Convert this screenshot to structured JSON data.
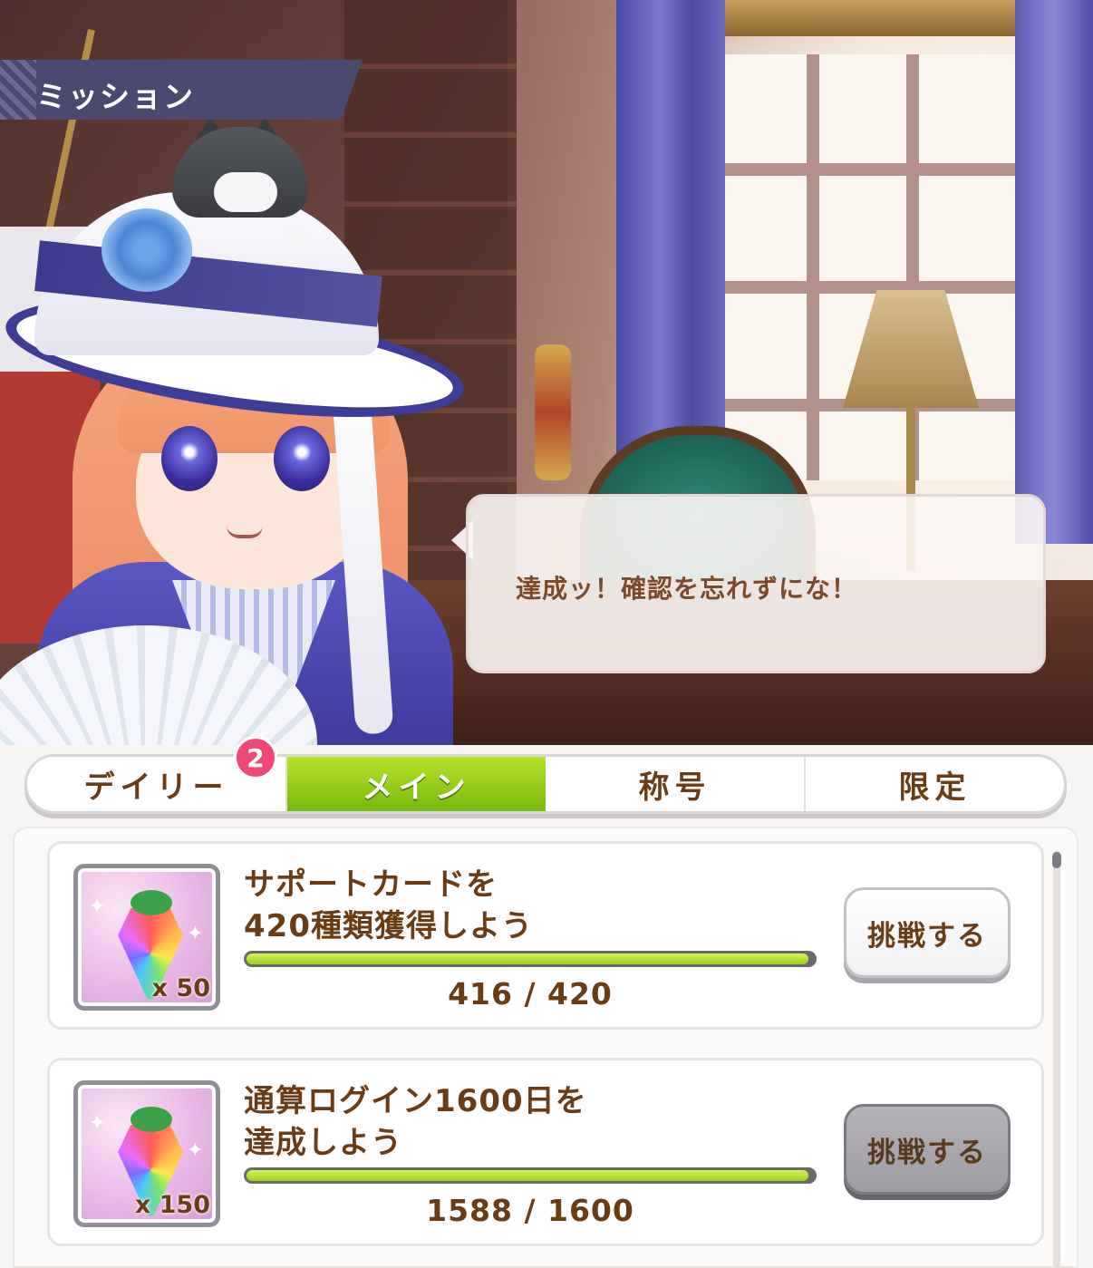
{
  "screen": {
    "title": "ミッション",
    "speech": "達成ッ！確認を忘れずにな！"
  },
  "tabs": {
    "badge": "2",
    "items": [
      {
        "label": "デイリー",
        "active": false
      },
      {
        "label": "メイン",
        "active": true
      },
      {
        "label": "称号",
        "active": false
      },
      {
        "label": "限定",
        "active": false
      }
    ]
  },
  "missions": [
    {
      "title_line1": "サポートカードを",
      "title_line2": "420種類獲得しよう",
      "reward_qty": "x 50",
      "progress_text": "416 / 420",
      "progress_fraction": 0.99,
      "button_label": "挑戦する",
      "button_state": "enabled"
    },
    {
      "title_line1": "通算ログイン1600日を",
      "title_line2": "達成しよう",
      "reward_qty": "x 150",
      "progress_text": "1588 / 1600",
      "progress_fraction": 0.99,
      "button_label": "挑戦する",
      "button_state": "disabled"
    }
  ],
  "colors": {
    "text_brown": "#6b3c14",
    "tab_active": "#8cc81a",
    "badge": "#ef4778",
    "progress_fill": "#b6e042",
    "ribbon": "#4a4970"
  },
  "icons": {
    "reward": "rainbow-jewel-icon",
    "sparkle": "sparkle-icon"
  }
}
